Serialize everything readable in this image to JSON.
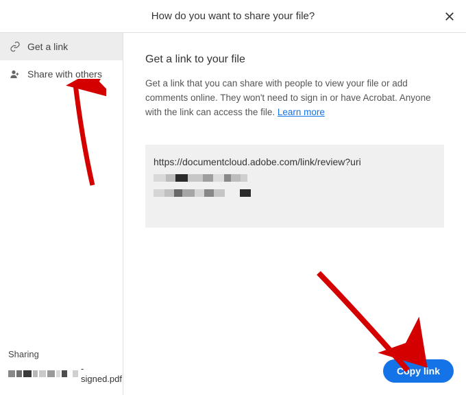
{
  "header": {
    "title": "How do you want to share your file?"
  },
  "sidebar": {
    "items": [
      {
        "label": "Get a link"
      },
      {
        "label": "Share with others"
      }
    ],
    "sharing_label": "Sharing",
    "filename_suffix": "-signed.pdf"
  },
  "main": {
    "title": "Get a link to your file",
    "description": "Get a link that you can share with people to view your file or add comments online. They won't need to sign in or have Acrobat. Anyone with the link can access the file. ",
    "learn_more": "Learn more",
    "url_prefix": "https://documentcloud.adobe.com/link/review?uri",
    "copy_button": "Copy link"
  },
  "colors": {
    "accent": "#1473e6",
    "arrow": "#d40000"
  }
}
